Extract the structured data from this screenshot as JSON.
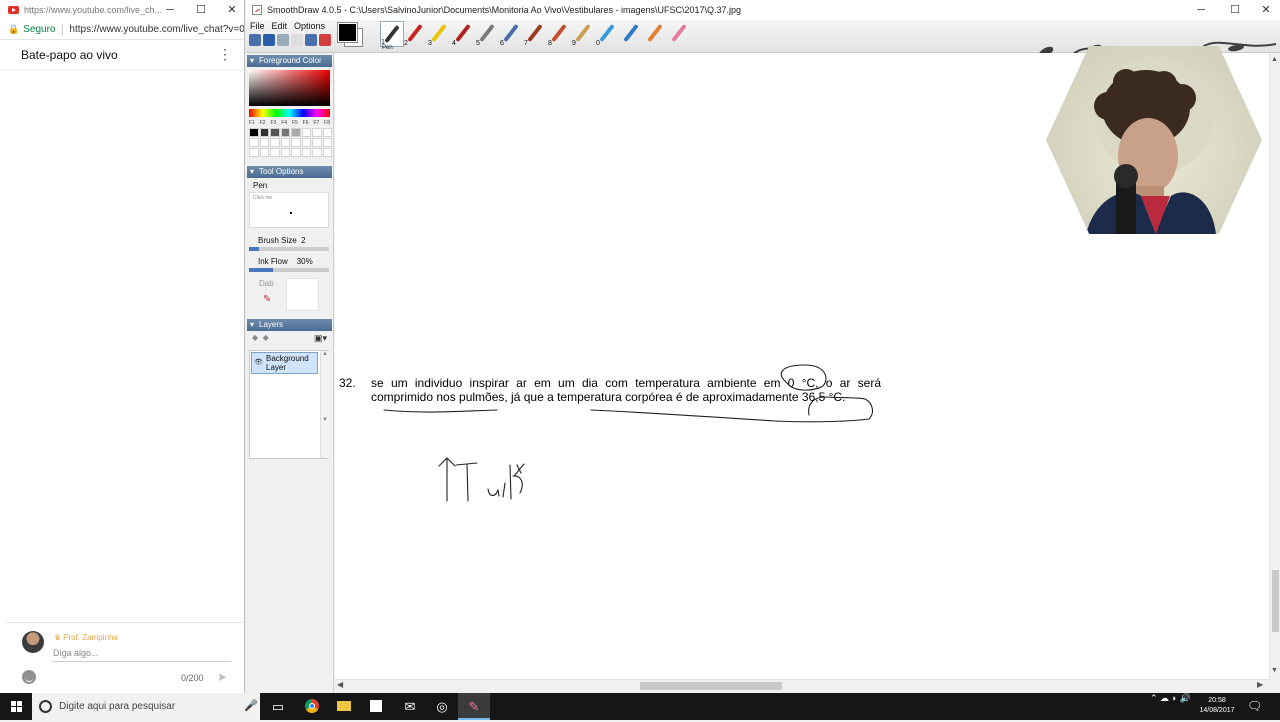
{
  "chat": {
    "tab_title": "https://www.youtube.com/live_ch...",
    "window_controls": {
      "minimize": "─",
      "maximize": "☐",
      "close": "✕"
    },
    "secure_label": "Seguro",
    "url": "https://www.youtube.com/live_chat?v=0...",
    "header_title": "Bate-papo ao vivo",
    "menu_icon": "⋮",
    "author": "Prof. Zampinha",
    "input_placeholder": "Diga algo...",
    "char_count": "0/200",
    "send_icon": "➤"
  },
  "smoothdraw": {
    "title": "SmoothDraw 4.0.5 - C:\\Users\\SalvinoJunior\\Documents\\Monitoria Ao Vivo\\Vestibulares - imagens\\UFSC\\2017\\Q.37.jpg",
    "window_controls": {
      "minimize": "─",
      "maximize": "☐",
      "close": "✕"
    },
    "menus": [
      "File",
      "Edit",
      "Options"
    ],
    "brush_numbers": [
      "1",
      "2",
      "3",
      "4",
      "5",
      "6",
      "7",
      "8",
      "9",
      "0",
      "",
      ""
    ],
    "brush_colors": [
      "#333333",
      "#cc2222",
      "#e8c400",
      "#b32020",
      "#7a7a7a",
      "#4b6fa8",
      "#9c3b22",
      "#c05030",
      "#c8a050",
      "#3c9ad8",
      "#2e7bc6",
      "#e08030",
      "#e27ba0"
    ],
    "active_brush_label": "Pen",
    "foreground_color": "#000000",
    "panels": {
      "foreground_title": "Foreground Color",
      "preset_labels": [
        "F1",
        "F2",
        "F3",
        "F4",
        "F5",
        "F6",
        "F7",
        "F8"
      ],
      "preset_colors": [
        "#000000",
        "#333333",
        "#555555",
        "#777777",
        "#aaaaaa",
        "#ffffff",
        "#ffffff",
        "#ffffff"
      ],
      "tool_options_title": "Tool Options",
      "tool_name": "Pen",
      "preview_caption": "Click me",
      "brush_size_label": "Brush Size",
      "brush_size_value": "2",
      "brush_size_fraction": 0.12,
      "ink_flow_label": "Ink Flow",
      "ink_flow_value": "30%",
      "ink_flow_fraction": 0.3,
      "dab_label": "Dab",
      "layers_title": "Layers",
      "layer_name": "Background Layer"
    },
    "question": {
      "number": "32.",
      "text": "se um individuo inspirar ar em um dia com temperatura ambiente em 0 °C, o ar será comprimido nos pulmões, já que a temperatura corpórea é de aproximadamente 36,5 °C."
    }
  },
  "taskbar": {
    "search_placeholder": "Digite aqui para pesquisar",
    "clock_time": "20:58",
    "clock_date": "14/08/2017",
    "tray_icons": "⌃  ☁  ◗  🔊"
  },
  "colors": {
    "panel_header": "#4b6c92",
    "slider_fill": "#4a78c0",
    "youtube_red": "#e52d27",
    "secure_green": "#0b8043",
    "taskbar": "#161616"
  }
}
